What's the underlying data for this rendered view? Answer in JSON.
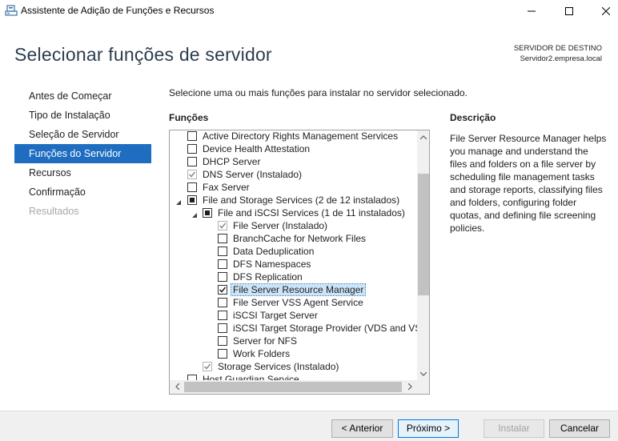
{
  "window": {
    "title": "Assistente de Adição de Funções e Recursos",
    "icon": "server-manager-icon",
    "controls": [
      "minimize-icon",
      "maximize-icon",
      "close-icon"
    ]
  },
  "header": {
    "title": "Selecionar funções de servidor",
    "destination_label": "SERVIDOR DE DESTINO",
    "destination_server": "Servidor2.empresa.local"
  },
  "nav": {
    "items": [
      {
        "label": "Antes de Começar",
        "state": "normal"
      },
      {
        "label": "Tipo de Instalação",
        "state": "normal"
      },
      {
        "label": "Seleção de Servidor",
        "state": "normal"
      },
      {
        "label": "Funções do Servidor",
        "state": "active"
      },
      {
        "label": "Recursos",
        "state": "normal"
      },
      {
        "label": "Confirmação",
        "state": "normal"
      },
      {
        "label": "Resultados",
        "state": "disabled"
      }
    ]
  },
  "main": {
    "instructions": "Selecione uma ou mais funções para instalar no servidor selecionado.",
    "roles_heading": "Funções",
    "description_heading": "Descrição",
    "description_text": "File Server Resource Manager helps you manage and understand the files and folders on a file server by scheduling file management tasks and storage reports, classifying files and folders, configuring folder quotas, and defining file screening policies."
  },
  "roles": [
    {
      "label": "Active Directory Rights Management Services",
      "level": 1,
      "check": "unchecked",
      "disabled": false,
      "expander": "none",
      "selected": false
    },
    {
      "label": "Device Health Attestation",
      "level": 1,
      "check": "unchecked",
      "disabled": false,
      "expander": "none",
      "selected": false
    },
    {
      "label": "DHCP Server",
      "level": 1,
      "check": "unchecked",
      "disabled": false,
      "expander": "none",
      "selected": false
    },
    {
      "label": "DNS Server (Instalado)",
      "level": 1,
      "check": "checked",
      "disabled": true,
      "expander": "none",
      "selected": false
    },
    {
      "label": "Fax Server",
      "level": 1,
      "check": "unchecked",
      "disabled": false,
      "expander": "none",
      "selected": false
    },
    {
      "label": "File and Storage Services (2 de 12 instalados)",
      "level": 1,
      "check": "partial",
      "disabled": false,
      "expander": "expanded",
      "selected": false
    },
    {
      "label": "File and iSCSI Services (1 de 11 instalados)",
      "level": 2,
      "check": "partial",
      "disabled": false,
      "expander": "expanded",
      "selected": false
    },
    {
      "label": "File Server (Instalado)",
      "level": 3,
      "check": "checked",
      "disabled": true,
      "expander": "none",
      "selected": false
    },
    {
      "label": "BranchCache for Network Files",
      "level": 3,
      "check": "unchecked",
      "disabled": false,
      "expander": "none",
      "selected": false
    },
    {
      "label": "Data Deduplication",
      "level": 3,
      "check": "unchecked",
      "disabled": false,
      "expander": "none",
      "selected": false
    },
    {
      "label": "DFS Namespaces",
      "level": 3,
      "check": "unchecked",
      "disabled": false,
      "expander": "none",
      "selected": false
    },
    {
      "label": "DFS Replication",
      "level": 3,
      "check": "unchecked",
      "disabled": false,
      "expander": "none",
      "selected": false
    },
    {
      "label": "File Server Resource Manager",
      "level": 3,
      "check": "checked",
      "disabled": false,
      "expander": "none",
      "selected": true
    },
    {
      "label": "File Server VSS Agent Service",
      "level": 3,
      "check": "unchecked",
      "disabled": false,
      "expander": "none",
      "selected": false
    },
    {
      "label": "iSCSI Target Server",
      "level": 3,
      "check": "unchecked",
      "disabled": false,
      "expander": "none",
      "selected": false
    },
    {
      "label": "iSCSI Target Storage Provider (VDS and VSS",
      "level": 3,
      "check": "unchecked",
      "disabled": false,
      "expander": "none",
      "selected": false
    },
    {
      "label": "Server for NFS",
      "level": 3,
      "check": "unchecked",
      "disabled": false,
      "expander": "none",
      "selected": false
    },
    {
      "label": "Work Folders",
      "level": 3,
      "check": "unchecked",
      "disabled": false,
      "expander": "none",
      "selected": false
    },
    {
      "label": "Storage Services (Instalado)",
      "level": 2,
      "check": "checked",
      "disabled": true,
      "expander": "none",
      "selected": false
    },
    {
      "label": "Host Guardian Service",
      "level": 1,
      "check": "unchecked",
      "disabled": false,
      "expander": "none",
      "selected": false
    }
  ],
  "buttons": {
    "previous": "< Anterior",
    "next": "Próximo >",
    "install": "Instalar",
    "cancel": "Cancelar"
  }
}
